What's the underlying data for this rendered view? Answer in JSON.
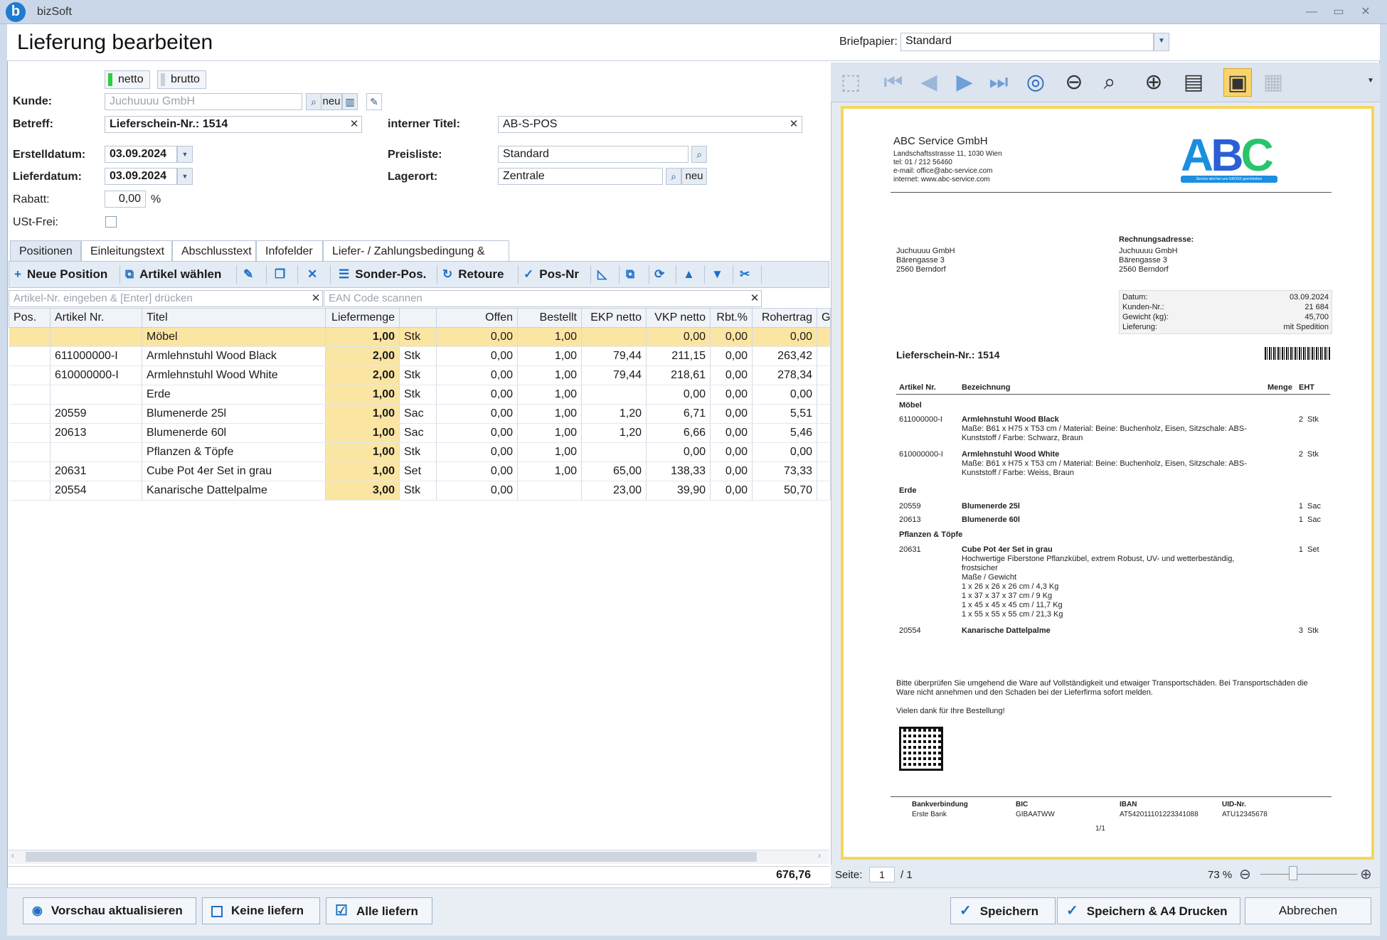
{
  "app": {
    "title": "bizSoft"
  },
  "window": {
    "minimize": "—",
    "restore": "▭",
    "close": "✕"
  },
  "header": {
    "title": "Lieferung bearbeiten",
    "briefpapier_label": "Briefpapier:",
    "briefpapier_value": "Standard"
  },
  "form": {
    "toggle_netto": "netto",
    "toggle_brutto": "brutto",
    "kunde_label": "Kunde:",
    "kunde_placeholder": "Juchuuuu GmbH",
    "kunde_neu": "neu",
    "betreff_label": "Betreff:",
    "betreff_value": "Lieferschein-Nr.: 1514",
    "interner_titel_label": "interner Titel:",
    "interner_titel_value": "AB-S-POS",
    "erstelldatum_label": "Erstelldatum:",
    "erstelldatum_value": "03.09.2024",
    "lieferdatum_label": "Lieferdatum:",
    "lieferdatum_value": "03.09.2024",
    "preisliste_label": "Preisliste:",
    "preisliste_value": "Standard",
    "lagerort_label": "Lagerort:",
    "lagerort_value": "Zentrale",
    "lagerort_neu": "neu",
    "rabatt_label": "Rabatt:",
    "rabatt_value": "0,00",
    "rabatt_unit": "%",
    "ustfrei_label": "USt-Frei:"
  },
  "tabs": [
    "Positionen",
    "Einleitungstext",
    "Abschlusstext",
    "Infofelder",
    "Liefer- / Zahlungsbedingung & Co"
  ],
  "toolbar": {
    "neue_position": "Neue Position",
    "artikel_waehlen": "Artikel wählen",
    "sonder_pos": "Sonder-Pos.",
    "retoure": "Retoure",
    "pos_nr": "Pos-Nr"
  },
  "filters": {
    "artikel_placeholder": "Artikel-Nr. eingeben & [Enter] drücken",
    "ean_placeholder": "EAN Code scannen"
  },
  "table": {
    "headers": [
      "Pos.",
      "Artikel Nr.",
      "Titel",
      "Liefermenge",
      "",
      "Offen",
      "Bestellt",
      "EKP netto",
      "VKP netto",
      "Rbt.%",
      "Rohertrag",
      "G"
    ],
    "rows": [
      {
        "pos": "",
        "artnr": "",
        "titel": "Möbel",
        "menge": "1,00",
        "einheit": "Stk",
        "offen": "0,00",
        "bestellt": "1,00",
        "ekp": "",
        "vkp": "0,00",
        "rbt": "0,00",
        "rohertrag": "0,00"
      },
      {
        "pos": "",
        "artnr": "611000000-I",
        "titel": "Armlehnstuhl Wood Black",
        "menge": "2,00",
        "einheit": "Stk",
        "offen": "0,00",
        "bestellt": "1,00",
        "ekp": "79,44",
        "vkp": "211,15",
        "rbt": "0,00",
        "rohertrag": "263,42"
      },
      {
        "pos": "",
        "artnr": "610000000-I",
        "titel": "Armlehnstuhl Wood White",
        "menge": "2,00",
        "einheit": "Stk",
        "offen": "0,00",
        "bestellt": "1,00",
        "ekp": "79,44",
        "vkp": "218,61",
        "rbt": "0,00",
        "rohertrag": "278,34"
      },
      {
        "pos": "",
        "artnr": "",
        "titel": "Erde",
        "menge": "1,00",
        "einheit": "Stk",
        "offen": "0,00",
        "bestellt": "1,00",
        "ekp": "",
        "vkp": "0,00",
        "rbt": "0,00",
        "rohertrag": "0,00"
      },
      {
        "pos": "",
        "artnr": "20559",
        "titel": "Blumenerde 25l",
        "menge": "1,00",
        "einheit": "Sac",
        "offen": "0,00",
        "bestellt": "1,00",
        "ekp": "1,20",
        "vkp": "6,71",
        "rbt": "0,00",
        "rohertrag": "5,51"
      },
      {
        "pos": "",
        "artnr": "20613",
        "titel": "Blumenerde 60l",
        "menge": "1,00",
        "einheit": "Sac",
        "offen": "0,00",
        "bestellt": "1,00",
        "ekp": "1,20",
        "vkp": "6,66",
        "rbt": "0,00",
        "rohertrag": "5,46"
      },
      {
        "pos": "",
        "artnr": "",
        "titel": "Pflanzen & Töpfe",
        "menge": "1,00",
        "einheit": "Stk",
        "offen": "0,00",
        "bestellt": "1,00",
        "ekp": "",
        "vkp": "0,00",
        "rbt": "0,00",
        "rohertrag": "0,00"
      },
      {
        "pos": "",
        "artnr": "20631",
        "titel": "Cube Pot 4er Set in grau",
        "menge": "1,00",
        "einheit": "Set",
        "offen": "0,00",
        "bestellt": "1,00",
        "ekp": "65,00",
        "vkp": "138,33",
        "rbt": "0,00",
        "rohertrag": "73,33"
      },
      {
        "pos": "",
        "artnr": "20554",
        "titel": "Kanarische Dattelpalme",
        "menge": "3,00",
        "einheit": "Stk",
        "offen": "0,00",
        "bestellt": "",
        "ekp": "23,00",
        "vkp": "39,90",
        "rbt": "0,00",
        "rohertrag": "50,70"
      }
    ],
    "total_rohertrag": "676,76"
  },
  "footer": {
    "vorschau": "Vorschau aktualisieren",
    "keine_liefern": "Keine liefern",
    "alle_liefern": "Alle liefern",
    "speichern": "Speichern",
    "speichern_drucken": "Speichern & A4 Drucken",
    "abbrechen": "Abbrechen"
  },
  "preview": {
    "seite_label": "Seite:",
    "seite_value": "1",
    "seite_total": "/ 1",
    "zoom": "73 %",
    "company": "ABC Service GmbH",
    "company_lines": [
      "Landschaftsstrasse 11, 1030 Wien",
      "tel: 01 / 212 56460",
      "e-mail: office@abc-service.com",
      "internet: www.abc-service.com"
    ],
    "logo_text": "ABC",
    "logo_tagline": "Service wird bei uns GROSS geschrieben",
    "address_lines": [
      "Juchuuuu GmbH",
      "Bärengasse 3",
      "2560 Berndorf"
    ],
    "rechnung_label": "Rechnungsadresse:",
    "rechnung_lines": [
      "Juchuuuu GmbH",
      "Bärengasse 3",
      "2560 Berndorf"
    ],
    "info": [
      {
        "k": "Datum:",
        "v": "03.09.2024"
      },
      {
        "k": "Kunden-Nr.:",
        "v": "21 684"
      },
      {
        "k": "Gewicht (kg):",
        "v": "45,700"
      },
      {
        "k": "Lieferung:",
        "v": "mit Spedition"
      }
    ],
    "doc_title": "Lieferschein-Nr.: 1514",
    "col_artnr": "Artikel Nr.",
    "col_bez": "Bezeichnung",
    "col_menge": "Menge",
    "col_eht": "EHT",
    "groups": [
      "Möbel",
      "Erde",
      "Pflanzen & Töpfe"
    ],
    "items": [
      {
        "nr": "611000000-I",
        "name": "Armlehnstuhl Wood Black",
        "desc": [
          "Maße: B61 x H75 x T53 cm / Material: Beine: Buchenholz, Eisen, Sitzschale: ABS-",
          "Kunststoff / Farbe: Schwarz, Braun"
        ],
        "qty": "2",
        "unit": "Stk"
      },
      {
        "nr": "610000000-I",
        "name": "Armlehnstuhl Wood White",
        "desc": [
          "Maße: B61 x H75 x T53 cm / Material: Beine: Buchenholz, Eisen, Sitzschale: ABS-",
          "Kunststoff / Farbe: Weiss, Braun"
        ],
        "qty": "2",
        "unit": "Stk"
      },
      {
        "nr": "20559",
        "name": "Blumenerde 25l",
        "desc": [],
        "qty": "1",
        "unit": "Sac"
      },
      {
        "nr": "20613",
        "name": "Blumenerde 60l",
        "desc": [],
        "qty": "1",
        "unit": "Sac"
      },
      {
        "nr": "20631",
        "name": "Cube Pot 4er Set in grau",
        "desc": [
          "Hochwertige Fiberstone Pflanzkübel, extrem Robust, UV- und wetterbeständig,",
          "frostsicher",
          "Maße / Gewicht",
          "1 x 26 x 26 x 26 cm / 4,3 Kg",
          "1 x 37 x 37 x 37 cm / 9 Kg",
          "1 x 45 x 45 x 45 cm / 11,7 Kg",
          "1 x 55 x 55 x 55 cm / 21,3 Kg"
        ],
        "qty": "1",
        "unit": "Set"
      },
      {
        "nr": "20554",
        "name": "Kanarische Dattelpalme",
        "desc": [],
        "qty": "3",
        "unit": "Stk"
      }
    ],
    "note_lines": [
      "Bitte überprüfen Sie umgehend die Ware auf Vollständigkeit und etwaiger Transportschäden. Bei Transportschäden die",
      "Ware nicht annehmen und den Schaden bei der Lieferfirma sofort melden."
    ],
    "thanks": "Vielen dank für Ihre Bestellung!",
    "bank": [
      {
        "k": "Bankverbindung",
        "v": "Erste Bank"
      },
      {
        "k": "BIC",
        "v": "GIBAATWW"
      },
      {
        "k": "IBAN",
        "v": "AT542011101223341088"
      },
      {
        "k": "UID-Nr.",
        "v": "ATU12345678"
      }
    ],
    "page_no": "1/1"
  }
}
